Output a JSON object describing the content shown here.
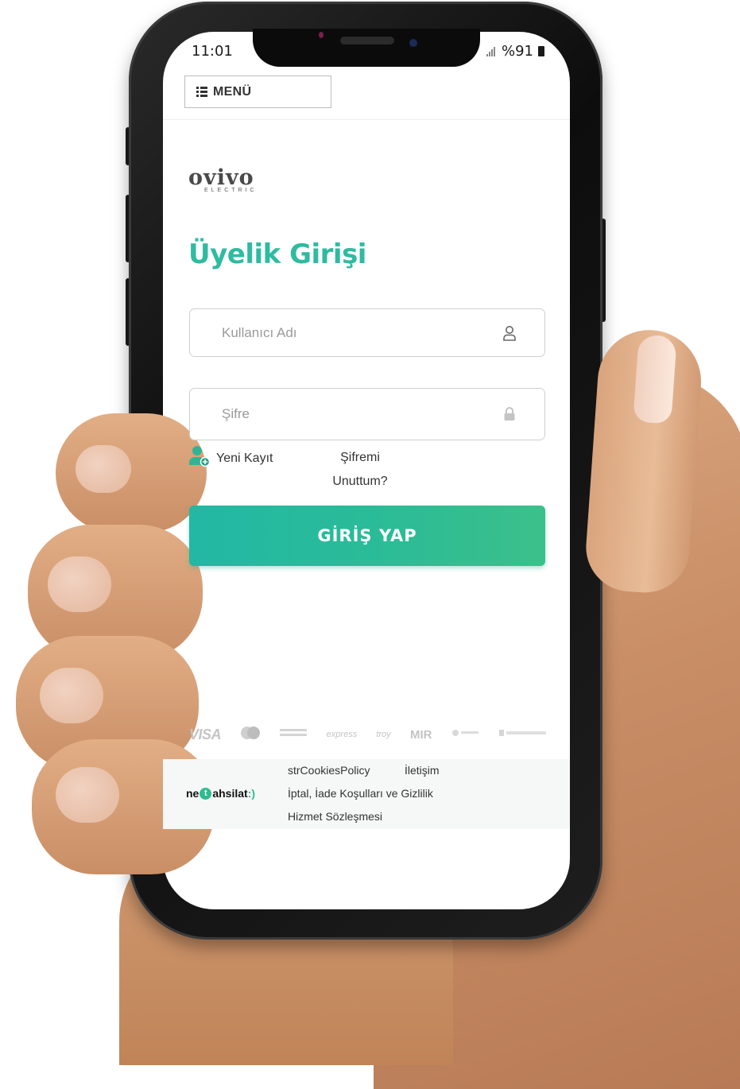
{
  "status_bar": {
    "time": "11:01",
    "battery": "%91"
  },
  "header": {
    "menu_label": "MENÜ"
  },
  "brand": {
    "logo_text": "ovivo",
    "logo_sub": "ELECTRIC",
    "accent_color": "#2fbba0"
  },
  "login": {
    "title": "Üyelik Girişi",
    "username_placeholder": "Kullanıcı Adı",
    "password_placeholder": "Şifre",
    "signup_label": "Yeni Kayıt",
    "forgot_label": "Şifremi Unuttum?",
    "submit_label": "GİRİŞ YAP"
  },
  "payments": {
    "visa": "VISA",
    "mir": "MIR",
    "troy": "troy",
    "express": "express"
  },
  "footer": {
    "brand": {
      "pre": "ne",
      "badge": "t",
      "post": "ahsilat",
      "smile": ":)"
    },
    "links": {
      "cookies": "strCookiesPolicy",
      "contact": "İletişim",
      "cancel": "İptal, İade Koşulları ve Gizlilik",
      "service": "Hizmet Sözleşmesi"
    }
  }
}
